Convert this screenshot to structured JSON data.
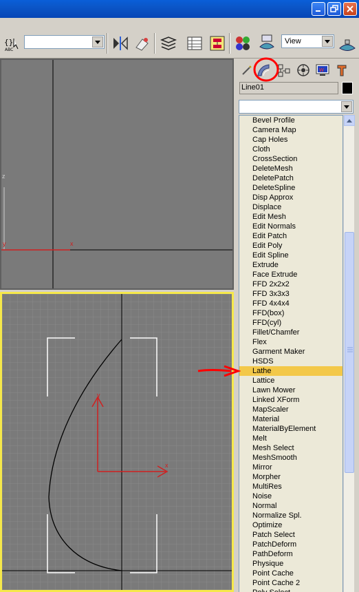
{
  "toolbar": {
    "selection_set_value": "",
    "reference_coord_value": "View"
  },
  "viewport_top": {
    "axis_z_label": "z",
    "axis_x_label": "x",
    "axis_y_label": "y"
  },
  "viewport_bottom": {
    "axis_x_label": "x",
    "axis_y_label": "y"
  },
  "command_panel": {
    "object_name": "Line01",
    "object_color": "#000000",
    "modifier_list_value": "",
    "selected_modifier": "Lathe",
    "modifiers": [
      "Bevel Profile",
      "Camera Map",
      "Cap Holes",
      "Cloth",
      "CrossSection",
      "DeleteMesh",
      "DeletePatch",
      "DeleteSpline",
      "Disp Approx",
      "Displace",
      "Edit Mesh",
      "Edit Normals",
      "Edit Patch",
      "Edit Poly",
      "Edit Spline",
      "Extrude",
      "Face Extrude",
      "FFD 2x2x2",
      "FFD 3x3x3",
      "FFD 4x4x4",
      "FFD(box)",
      "FFD(cyl)",
      "Fillet/Chamfer",
      "Flex",
      "Garment Maker",
      "HSDS",
      "Lathe",
      "Lattice",
      "Lawn Mower",
      "Linked XForm",
      "MapScaler",
      "Material",
      "MaterialByElement",
      "Melt",
      "Mesh Select",
      "MeshSmooth",
      "Mirror",
      "Morpher",
      "MultiRes",
      "Noise",
      "Normal",
      "Normalize Spl.",
      "Optimize",
      "Patch Select",
      "PatchDeform",
      "PathDeform",
      "Physique",
      "Point Cache",
      "Point Cache 2",
      "Poly Select"
    ]
  },
  "colors": {
    "viewport_bg": "#7a7a7a",
    "active_viewport_border": "#f6e84a",
    "selection_highlight": "#f3c849",
    "annotation_red": "#ff0000"
  }
}
